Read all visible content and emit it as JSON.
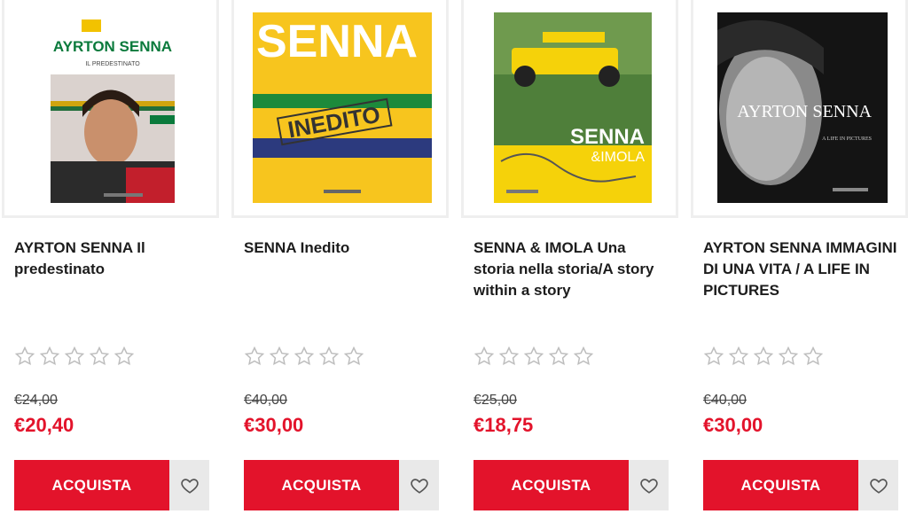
{
  "products": [
    {
      "title": "AYRTON SENNA Il predestinato",
      "old_price": "€24,00",
      "price": "€20,40",
      "buy_label": "ACQUISTA",
      "rating": 0,
      "cover": {
        "main": "AYRTON SENNA",
        "sub": "IL PREDESTINATO"
      }
    },
    {
      "title": "SENNA Inedito",
      "old_price": "€40,00",
      "price": "€30,00",
      "buy_label": "ACQUISTA",
      "rating": 0,
      "cover": {
        "main": "SENNA",
        "sub": "INEDITO"
      }
    },
    {
      "title": "SENNA & IMOLA Una storia nella storia/A story within a story",
      "old_price": "€25,00",
      "price": "€18,75",
      "buy_label": "ACQUISTA",
      "rating": 0,
      "cover": {
        "main": "SENNA",
        "sub": "&IMOLA"
      }
    },
    {
      "title": "AYRTON SENNA IMMAGINI DI UNA VITA / A LIFE IN PICTURES",
      "old_price": "€40,00",
      "price": "€30,00",
      "buy_label": "ACQUISTA",
      "rating": 0,
      "cover": {
        "main": "AYRTON SENNA",
        "sub": "A LIFE IN PICTURES"
      }
    }
  ],
  "icons": {
    "rating": "star-outline-icon",
    "wishlist": "heart-outline-icon"
  },
  "colors": {
    "accent": "#e3132b",
    "wishlist_bg": "#e9e9e9",
    "border": "#efefef"
  }
}
